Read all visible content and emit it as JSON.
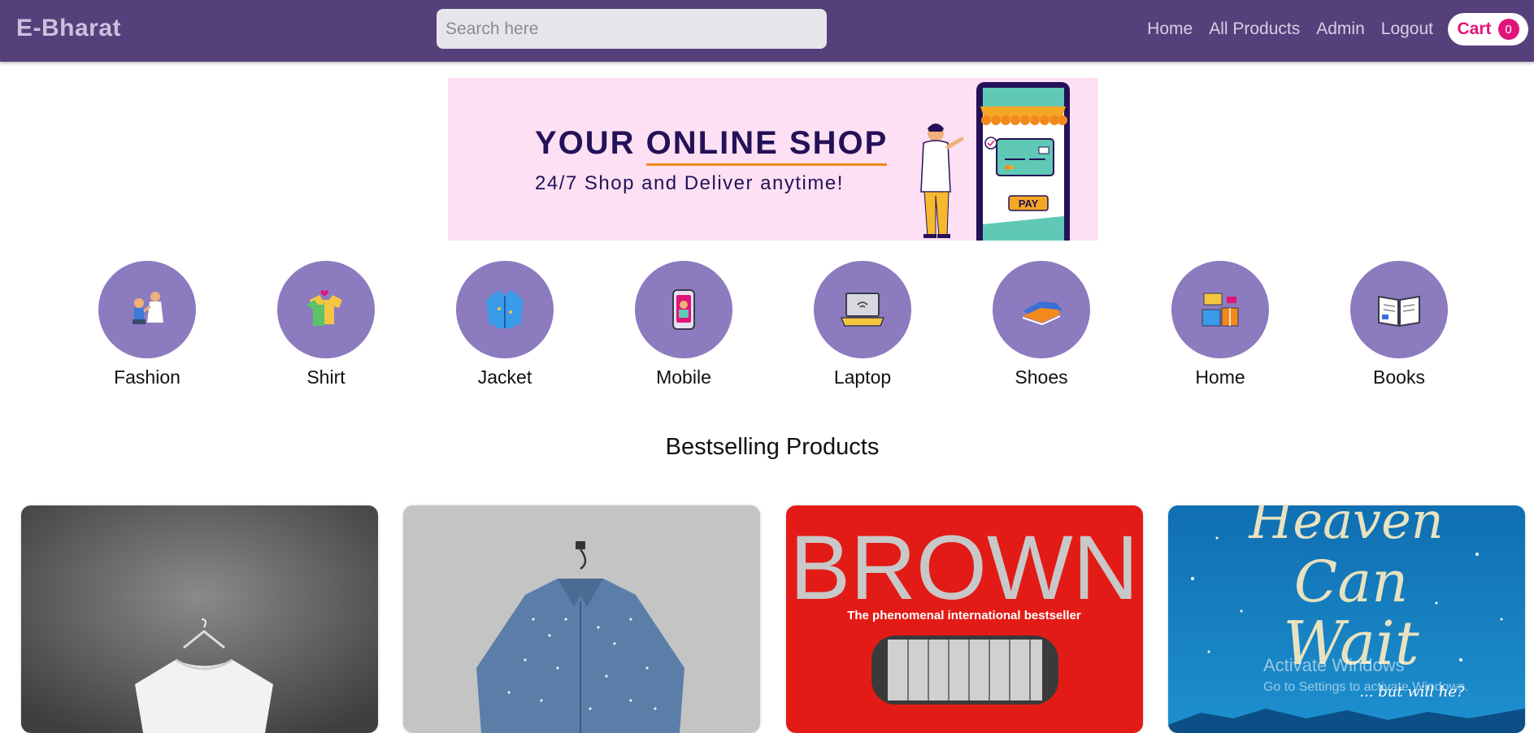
{
  "navbar": {
    "brand": "E-Bharat",
    "search_placeholder": "Search here",
    "links": [
      "Home",
      "All Products",
      "Admin",
      "Logout"
    ],
    "cart_label": "Cart",
    "cart_count": "0"
  },
  "hero": {
    "title": "YOUR ONLINE SHOP",
    "subtitle": "24/7 Shop and Deliver anytime!",
    "pay_label": "PAY"
  },
  "categories": [
    {
      "label": "Fashion",
      "icon": "couple-icon"
    },
    {
      "label": "Shirt",
      "icon": "tshirt-icon"
    },
    {
      "label": "Jacket",
      "icon": "jacket-icon"
    },
    {
      "label": "Mobile",
      "icon": "mobile-icon"
    },
    {
      "label": "Laptop",
      "icon": "laptop-icon"
    },
    {
      "label": "Shoes",
      "icon": "shoes-icon"
    },
    {
      "label": "Home",
      "icon": "furniture-icon"
    },
    {
      "label": "Books",
      "icon": "book-icon"
    }
  ],
  "section_title": "Bestselling Products",
  "products": {
    "book1_author": "BROWN",
    "book1_tagline": "The phenomenal international bestseller",
    "book2_title_line1": "Heaven",
    "book2_title_line2": "Can",
    "book2_title_line3": "Wait",
    "book2_tagline": "... but will he?"
  },
  "os_watermark": {
    "line1": "Activate Windows",
    "line2": "Go to Settings to activate Windows."
  },
  "colors": {
    "navbar": "#56407b",
    "accent_pink": "#e0157a",
    "category_circle": "#8c7bbf",
    "hero_bg": "#fde0f3"
  }
}
